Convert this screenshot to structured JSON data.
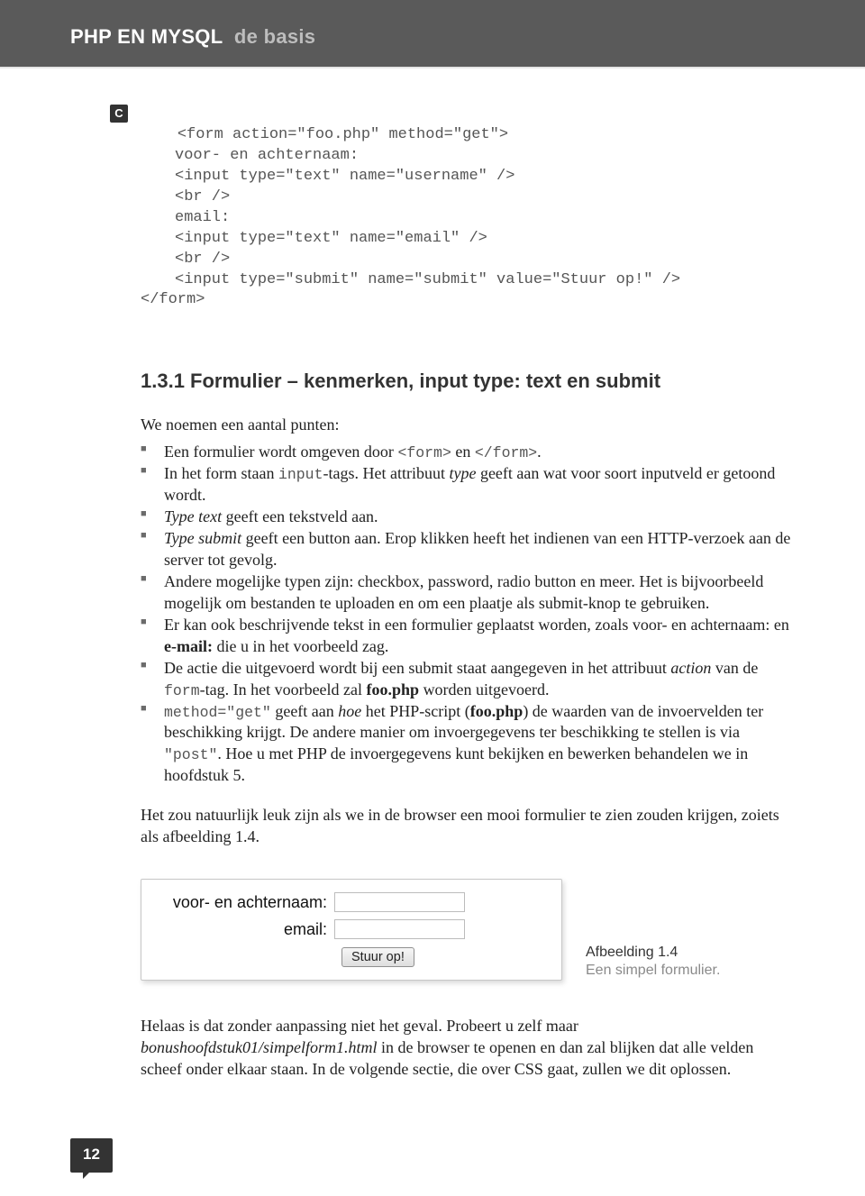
{
  "header": {
    "title": "PHP EN MYSQL",
    "subtitle": "de basis"
  },
  "code": {
    "marker": "C",
    "l1": "<form action=\"foo.php\" method=\"get\">",
    "l2": "voor- en achternaam:",
    "l3": "<input type=\"text\" name=\"username\" />",
    "l4": "<br />",
    "l5": "email:",
    "l6": "<input type=\"text\" name=\"email\" />",
    "l7": "<br />",
    "l8": "<input type=\"submit\" name=\"submit\" value=\"Stuur op!\" />",
    "l9": "</form>"
  },
  "section_heading": "1.3.1  Formulier – kenmerken, input type: text en submit",
  "intro": "We noemen een aantal punten:",
  "bullets": {
    "b1_a": "Een formulier wordt omgeven door ",
    "b1_code1": "<form>",
    "b1_mid": " en ",
    "b1_code2": "</form>",
    "b1_end": ".",
    "b2_a": "In het form staan ",
    "b2_code": "input",
    "b2_b": "-tags. Het attribuut ",
    "b2_em": "type",
    "b2_c": " geeft aan wat voor soort inputveld er getoond wordt.",
    "b3_em": "Type text",
    "b3_rest": " geeft een tekstveld aan.",
    "b4_em": "Type submit",
    "b4_rest": " geeft een button aan. Erop klikken heeft het indienen van een HTTP-verzoek aan de server tot gevolg.",
    "b5": "Andere mogelijke typen zijn: checkbox, password, radio button en meer. Het is bijvoorbeeld mogelijk om bestanden te uploaden en om een plaatje als submit-knop te gebruiken.",
    "b6_a": "Er kan ook beschrijvende tekst in een formulier geplaatst worden, zoals ",
    "b6_b1": "voor- en achternaam:",
    "b6_mid": " en ",
    "b6_b2": "e-mail:",
    "b6_end": " die u in het voorbeeld zag.",
    "b7_a": "De actie die uitgevoerd wordt bij een submit staat aangegeven in het attribuut ",
    "b7_em": "action",
    "b7_b": " van de ",
    "b7_code": "form",
    "b7_c": "-tag. In het voorbeeld zal ",
    "b7_bold": "foo.php",
    "b7_d": " worden uitgevoerd.",
    "b8_code1": "method=\"get\"",
    "b8_a": " geeft aan ",
    "b8_em": "hoe",
    "b8_b": " het PHP-script (",
    "b8_bold": "foo.php",
    "b8_c": ") de waarden van de invoervelden ter beschikking krijgt. De andere manier om invoergegevens ter beschikking te stellen is via ",
    "b8_code2": "\"post\"",
    "b8_d": ". Hoe u met PHP de invoergegevens kunt bekijken en bewerken behandelen we in hoofdstuk 5."
  },
  "para2": "Het zou natuurlijk leuk zijn als we in de browser een mooi formulier te zien zouden krijgen, zoiets als afbeelding 1.4.",
  "form": {
    "label1": "voor- en achternaam:",
    "label2": "email:",
    "submit": "Stuur op!"
  },
  "caption": {
    "title": "Afbeelding 1.4",
    "sub": "Een simpel formulier."
  },
  "closing_a": "Helaas is dat zonder aanpassing niet het geval. Probeert u zelf maar ",
  "closing_em": "bonushoofdstuk01/simpelform1.html",
  "closing_b": " in de browser te openen en dan zal blijken dat alle velden scheef onder elkaar staan. In de volgende sectie, die over CSS gaat, zullen we dit oplossen.",
  "page_number": "12"
}
